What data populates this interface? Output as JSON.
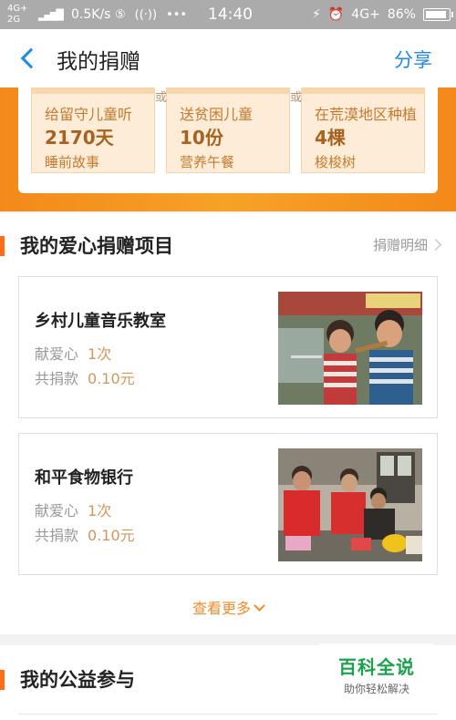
{
  "status_bar": {
    "network_top": "4G+",
    "network_bottom": "2G",
    "speed": "0.5K/s",
    "icons_left": [
      "sim-icon",
      "hotspot-icon",
      "more-dots-icon"
    ],
    "icons_left_glyphs": [
      "⑤",
      "((·))",
      "•••"
    ],
    "time": "14:40",
    "right_network": "4G+",
    "battery": "86%"
  },
  "header": {
    "title": "我的捐赠",
    "share_label": "分享"
  },
  "banner": {
    "separator": "或",
    "stats": [
      {
        "line1": "给留守儿童听",
        "value": "2170天",
        "line3": "睡前故事"
      },
      {
        "line1": "送贫困儿童",
        "value": "10份",
        "line3": "营养午餐"
      },
      {
        "line1": "在荒漠地区种植",
        "value": "4棵",
        "line3": "梭梭树"
      }
    ]
  },
  "projects_section": {
    "title": "我的爱心捐赠项目",
    "detail_link": "捐赠明细",
    "projects": [
      {
        "name": "乡村儿童音乐教室",
        "love_label": "献爱心",
        "love_value": "1次",
        "amount_label": "共捐款",
        "amount_value": "0.10元"
      },
      {
        "name": "和平食物银行",
        "love_label": "献爱心",
        "love_value": "1次",
        "amount_label": "共捐款",
        "amount_value": "0.10元"
      }
    ],
    "more_label": "查看更多"
  },
  "public_section": {
    "title": "我的公益参与"
  },
  "watermark": {
    "main": "百科全说",
    "sub": "助你轻松解决"
  },
  "colors": {
    "accent_blue": "#1e8ae6",
    "accent_orange": "#f3891a",
    "section_bar": "#ff6d1a",
    "value_brown": "#a6621f"
  }
}
